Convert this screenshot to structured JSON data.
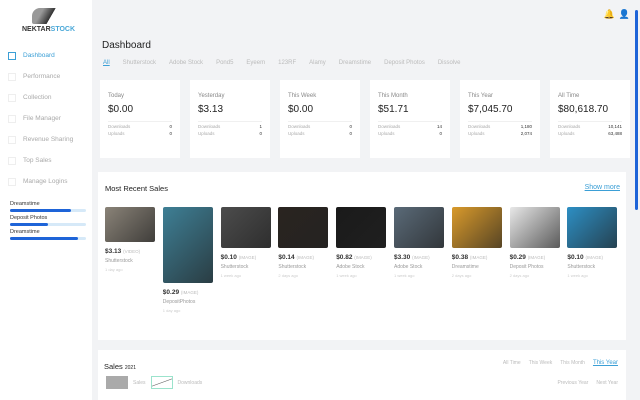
{
  "brand": {
    "name_a": "NEKTAR",
    "name_b": "STOCK"
  },
  "sidebar": {
    "items": [
      {
        "label": "Dashboard",
        "active": true
      },
      {
        "label": "Performance"
      },
      {
        "label": "Collection"
      },
      {
        "label": "File Manager"
      },
      {
        "label": "Revenue Sharing"
      },
      {
        "label": "Top Sales"
      },
      {
        "label": "Manage Logins"
      }
    ],
    "progress": [
      {
        "label": "Dreamstime",
        "value": 0.8
      },
      {
        "label": "Deposit Photos",
        "value": 0.5
      },
      {
        "label": "Dreamstime",
        "value": 0.9
      }
    ]
  },
  "header": {
    "title": "Dashboard",
    "tabs": [
      "All",
      "Shutterstock",
      "Adobe Stock",
      "Pond5",
      "Eyeem",
      "123RF",
      "Alamy",
      "Dreamstime",
      "Deposit Photos",
      "Dissolve"
    ]
  },
  "stats": [
    {
      "title": "Today",
      "value": "$0.00",
      "downloads": "0",
      "uploads": "0"
    },
    {
      "title": "Yesterday",
      "value": "$3.13",
      "downloads": "1",
      "uploads": "0"
    },
    {
      "title": "This Week",
      "value": "$0.00",
      "downloads": "0",
      "uploads": "0"
    },
    {
      "title": "This Month",
      "value": "$51.71",
      "downloads": "14",
      "uploads": "0"
    },
    {
      "title": "This Year",
      "value": "$7,045.70",
      "downloads": "1,180",
      "uploads": "2,074"
    },
    {
      "title": "All Time",
      "value": "$80,618.70",
      "downloads": "10,141",
      "uploads": "63,488"
    }
  ],
  "labels": {
    "downloads": "Downloads",
    "uploads": "Uploads"
  },
  "recent": {
    "title": "Most Recent Sales",
    "show_more": "Show more",
    "items": [
      {
        "price": "$3.13",
        "type": "(VIDEO)",
        "agency": "Shutterstock",
        "ago": "1 day ago",
        "color": "#8a8378"
      },
      {
        "price": "$0.29",
        "type": "(IMAGE)",
        "agency": "DepositPhotos",
        "ago": "1 day ago",
        "color": "#3e7f95"
      },
      {
        "price": "$0.10",
        "type": "(IMAGE)",
        "agency": "Shutterstock",
        "ago": "1 week ago",
        "color": "#4c4c4c"
      },
      {
        "price": "$0.14",
        "type": "(IMAGE)",
        "agency": "Shutterstock",
        "ago": "2 days ago",
        "color": "#2a2420"
      },
      {
        "price": "$0.82",
        "type": "(IMAGE)",
        "agency": "Adobe Stock",
        "ago": "1 week ago",
        "color": "#1a1a1a"
      },
      {
        "price": "$3.30",
        "type": "(IMAGE)",
        "agency": "Adobe Stock",
        "ago": "1 week ago",
        "color": "#5a6a78"
      },
      {
        "price": "$0.38",
        "type": "(IMAGE)",
        "agency": "Dreamstime",
        "ago": "2 days ago",
        "color": "#d99a2b"
      },
      {
        "price": "$0.29",
        "type": "(IMAGE)",
        "agency": "Deposit Photos",
        "ago": "2 days ago",
        "color": "#e8e8e8"
      },
      {
        "price": "$0.10",
        "type": "(IMAGE)",
        "agency": "Shutterstock",
        "ago": "1 week ago",
        "color": "#2d8fc4"
      }
    ]
  },
  "sales": {
    "title": "Sales",
    "year": "2021",
    "ranges": [
      "All Time",
      "This Week",
      "This Month",
      "This Year"
    ],
    "legend": [
      "Sales",
      "Downloads"
    ],
    "nav": [
      "Previous Year",
      "Next Year"
    ]
  }
}
